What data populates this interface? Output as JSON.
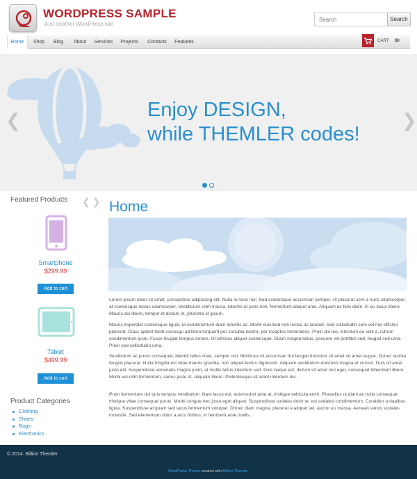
{
  "header": {
    "site_title": "WORDPRESS SAMPLE",
    "tagline": "Just another WordPress site",
    "search_placeholder": "Search",
    "search_button": "Search",
    "brand_color": "#b8242c"
  },
  "nav": {
    "items": [
      "Home",
      "Shop",
      "Blog",
      "About",
      "Services",
      "Projects",
      "Contacts",
      "Features"
    ],
    "active": "Home",
    "cart_label": "CART:",
    "cart_value": "$0"
  },
  "slider": {
    "line1": "Enjoy DESIGN,",
    "line2": "while THEMLER codes!",
    "prev_arrow": "❮",
    "next_arrow": "❯",
    "slide_count": 2,
    "active_slide": 1
  },
  "sidebar": {
    "featured_title": "Featured Products",
    "products": [
      {
        "name": "Smartphone",
        "price": "$299.99",
        "button": "Add to cart",
        "icon": "smartphone-icon"
      },
      {
        "name": "Tablet",
        "price": "$499.99",
        "button": "Add to cart",
        "icon": "tablet-icon"
      }
    ],
    "categories_title": "Product Categories",
    "categories": [
      "Clothing",
      "Shoes",
      "Bags",
      "Electronics"
    ]
  },
  "content": {
    "title": "Home",
    "paragraphs": [
      "Lorem ipsum dolor sit amet, consectetur adipiscing elit. Nulla in risus nisl. Sed scelerisque accumsan semper. Ut placerat sem a nunc ullamcorper, at scelerisque lectus ullamcorper. Vestibulum nibh massa, lobortis id justo non, fermentum aliquet ante. Aliquam ac felis diam. In eu lacus libero. Mauris dui libero, tempor et dictum et, pharetra id ipsum.",
      "Mauris imperdiet scelerisque ligula, id condimentum diam lobortis ac. Morbi euismod non lectus ac laoreet. Sed sollicitudin sem vel nisl efficitur placerat. Class aptent taciti sociosqu ad litora torquent per conubia nostra, per inceptos himenaeos. Proin dui leo, interdum eu velit a, rutrum condimentum justo. Fusce feugiat tempus ornare. Ut ultricies aliquet scelerisque. Etiam magna tellus, posuere vel porttitor sed, feugiat sed urna. Proin sed sollicitudin urna.",
      "Vestibulum ac purus consequat, blandit tellus vitae, semper nisl. Morbi eu mi accumsan dui feugiat tincidunt sit amet sit amet augue. Donec lacinia feugiat placerat. Nulla fringilla est vitae mauris gravida, non aliquet lectus dignissim. Aliquam vestibulum euismod magna et cursus. Duis sit amet justo elit. Suspendisse venenatis magna justo, at mollis tellus interdum sed. Duis neque est, dictum sit amet nisl eget, consequat bibendum libero. Morbi vel nibh fermentum, varius justo et, aliquam libero. Pellentesque sit amet interdum dui.",
      "Proin fermentum dui quis tempus vestibulum. Nam lacus dui, euismod et ante at, tristique vehicula enim. Phasellus ut diam ac nulla consequat tristique vitae consequat purus. Morbi congue nec justo eget aliquet. Suspendisse sodales dolor ac est sodales condimentum. Curabitur a dapibus ligula. Suspendisse at quam sed lacus fermentum volutpat. Donec diam magna, placerat a aliquet vel, auctor eu massa. Aenean varius sodales molestie. Sed elementum dolor a arcu finibus, in hendrerit ante mollis."
    ]
  },
  "footer": {
    "copyright": "© 2014. Billion Themler",
    "credit_link1": "WordPress Theme",
    "credit_middle": " created with ",
    "credit_link2": "Billion Themler",
    "credit_end": "."
  }
}
